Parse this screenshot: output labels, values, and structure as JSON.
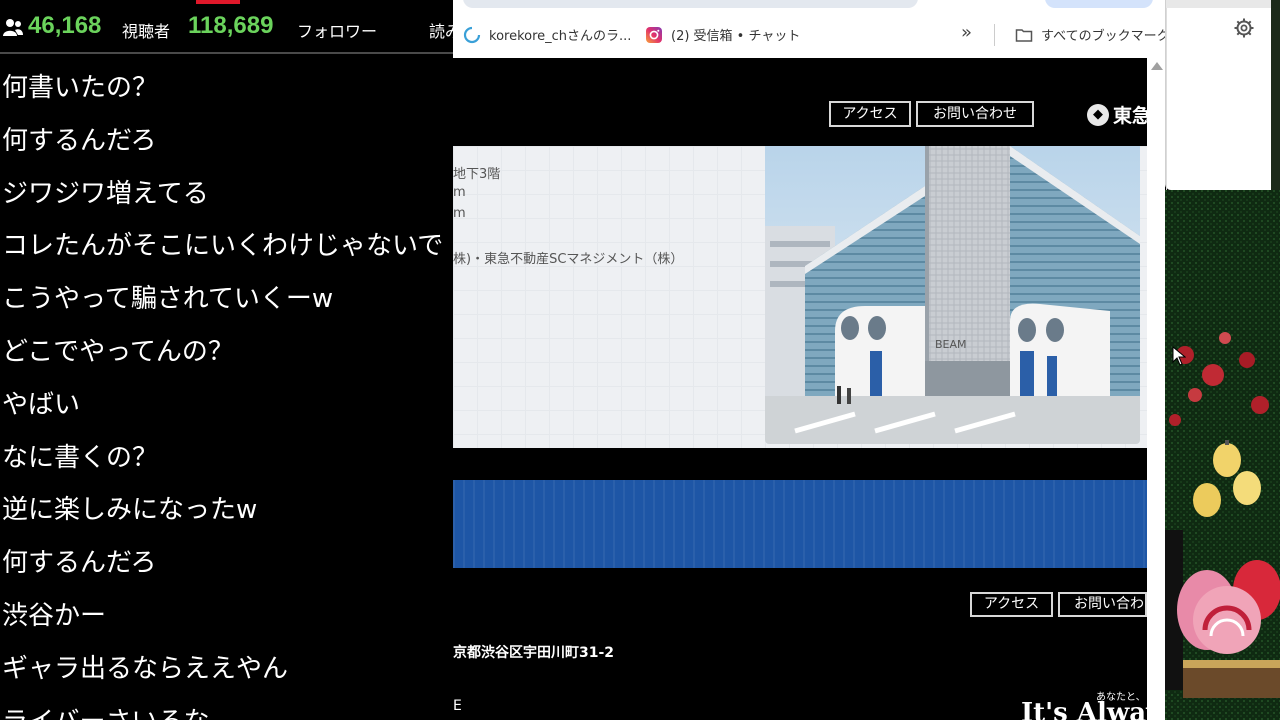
{
  "stream_stats": {
    "viewers": "46,168",
    "viewers_label": "視聴者",
    "followers": "118,689",
    "followers_label": "フォロワー",
    "truncated": "読み"
  },
  "chat": {
    "messages": [
      "何書いたの？",
      "何するんだろ",
      "ジワジワ増えてる",
      "コレたんがそこにいくわけじゃないで",
      "こうやって騙されていくーw",
      "どこでやってんの？",
      "やばい",
      "なに書くの？",
      "逆に楽しみになったw",
      "何するんだろ",
      "渋谷かー",
      "ギャラ出るならええやん",
      "ライバーさいるな"
    ]
  },
  "bookmarks": {
    "items": [
      {
        "label": "korekore_chさんのラ...",
        "icon": "twitch-icon"
      },
      {
        "label": "(2) 受信箱 • チャット",
        "icon": "instagram-icon"
      }
    ],
    "more_glyph": "»",
    "all_bookmarks": "すべてのブックマーク"
  },
  "page": {
    "header_buttons": {
      "access": "アクセス",
      "contact": "お問い合わせ"
    },
    "logo_text": "東急",
    "info_lines": [
      "地下3階",
      "m",
      "m",
      "株)・東急不動産SCマネジメント（株）"
    ],
    "building_sign": "BEAM",
    "footer_buttons": {
      "access": "アクセス",
      "contact": "お問い合わ"
    },
    "address": "京都渋谷区宇田川町31-2",
    "footer_mark": "E",
    "brand_sub": "あなたと、",
    "brand_slogan": "It's Always"
  },
  "colors": {
    "viewer_count": "#6bd35c",
    "banner_blue": "#1e56a6",
    "live_red": "#e0182a"
  }
}
